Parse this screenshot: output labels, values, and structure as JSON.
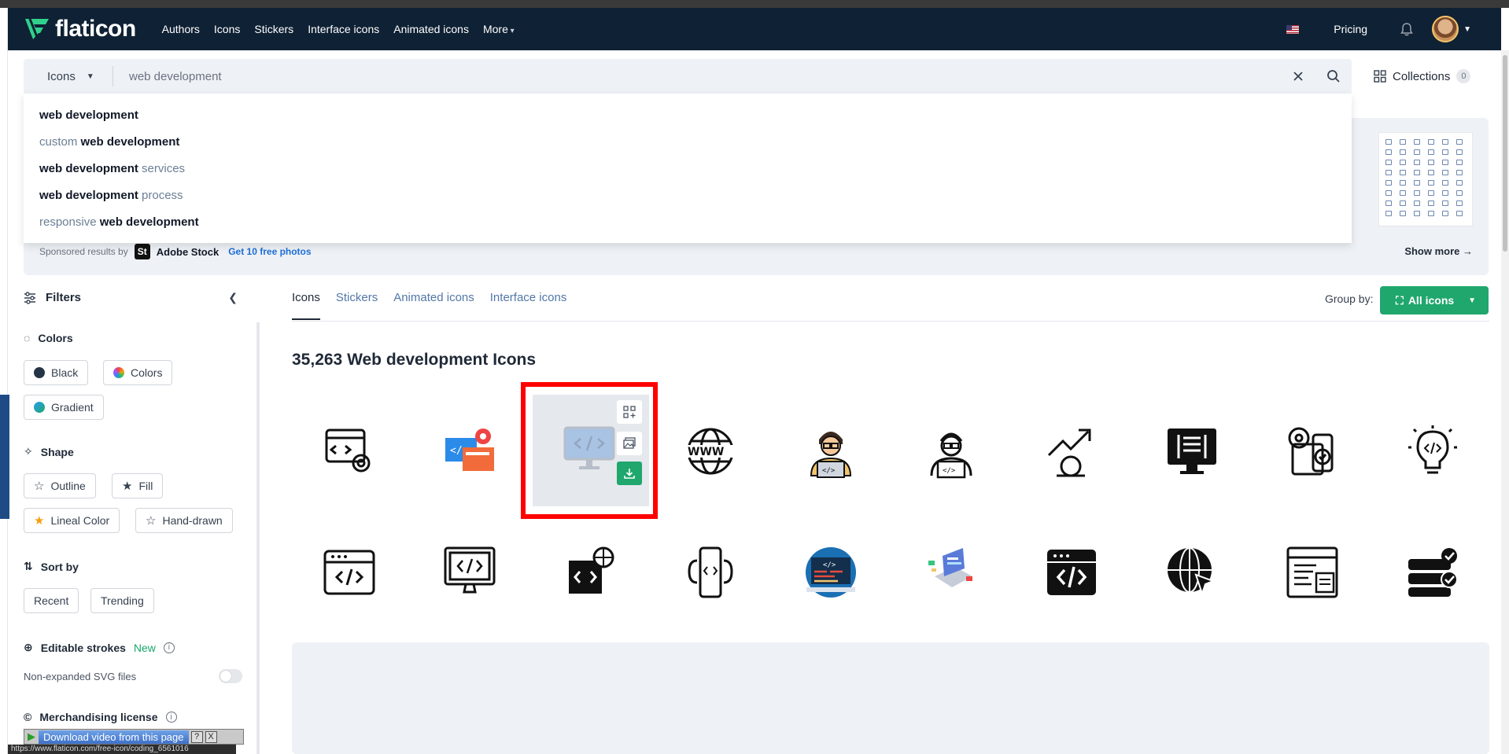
{
  "header": {
    "logo_text": "flaticon",
    "nav": [
      "Authors",
      "Icons",
      "Stickers",
      "Interface icons",
      "Animated icons",
      "More"
    ],
    "pricing": "Pricing"
  },
  "search": {
    "type": "Icons",
    "value": "web development"
  },
  "collections": {
    "label": "Collections",
    "count": "0"
  },
  "suggestions": [
    {
      "pre": "",
      "bold": "web development",
      "post": ""
    },
    {
      "pre": "custom ",
      "bold": "web development",
      "post": ""
    },
    {
      "pre": "",
      "bold": "web development",
      "post": " services"
    },
    {
      "pre": "",
      "bold": "web development",
      "post": " process"
    },
    {
      "pre": "responsive ",
      "bold": "web development",
      "post": ""
    }
  ],
  "sponsor": {
    "text": "Sponsored results by",
    "brand": "Adobe Stock",
    "logo": "St",
    "cta": "Get 10 free photos",
    "show_more": "Show more →"
  },
  "filters": {
    "title": "Filters",
    "colors_title": "Colors",
    "colors": [
      "Black",
      "Colors",
      "Gradient"
    ],
    "shape_title": "Shape",
    "shapes": [
      "Outline",
      "Fill",
      "Lineal Color",
      "Hand-drawn"
    ],
    "sort_title": "Sort by",
    "sorts": [
      "Recent",
      "Trending"
    ],
    "editable_title": "Editable strokes",
    "editable_new": "New",
    "nonexpanded": "Non-expanded SVG files",
    "merch_title": "Merchandising license"
  },
  "download_bar": {
    "label": "Download video from this page",
    "q": "?",
    "x": "X"
  },
  "status_url": "https://www.flaticon.com/free-icon/coding_6561016",
  "main": {
    "tabs": [
      "Icons",
      "Stickers",
      "Animated icons",
      "Interface icons"
    ],
    "group_by": "Group by:",
    "all_icons": "All icons",
    "results_title": "35,263 Web development Icons"
  },
  "icons": {
    "row1": [
      "web-settings-icon",
      "web-dev-color-icon",
      "coding-monitor-icon",
      "www-globe-icon",
      "developer-man-color-icon",
      "developer-man-outline-icon",
      "growth-gear-icon",
      "monitor-code-fill-icon",
      "mobile-settings-icon",
      "code-bulb-icon"
    ],
    "row2": [
      "browser-code-icon",
      "monitor-code-outline-icon",
      "web-code-globe-icon",
      "mobile-gear-code-icon",
      "code-screen-circle-icon",
      "laptop-isometric-icon",
      "browser-code-fill-icon",
      "globe-cursor-icon",
      "web-page-code-icon",
      "server-check-icon"
    ]
  },
  "colors": {
    "header_bg": "#0f2134",
    "accent_green": "#1fa76d",
    "link_blue": "#5277a8"
  }
}
